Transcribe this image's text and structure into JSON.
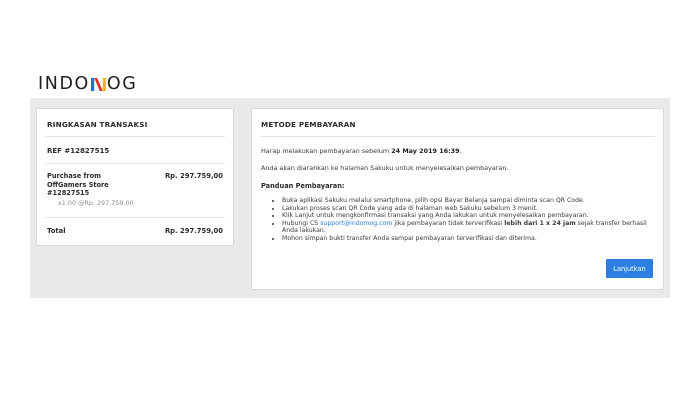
{
  "brand": {
    "logo_left": "INDO",
    "logo_right": "OG",
    "logo_mark": "m-icon"
  },
  "summary": {
    "title": "RINGKASAN TRANSAKSI",
    "ref": "REF #12827515",
    "item_name": "Purchase from OffGamers Store #12827515",
    "item_price": "Rp. 297.759,00",
    "item_qty": "x1.00 @Rp. 297.759,00",
    "total_label": "Total",
    "total_value": "Rp. 297.759,00"
  },
  "payment": {
    "title": "METODE PEMBAYARAN",
    "deadline_text": "Harap melakukan pembayaran sebelum",
    "deadline_value": "24 May 2019 16:39",
    "deadline_end": ".",
    "redirect_text": "Anda akan diarahkan ke halaman Sakuku untuk menyelesaikan pembayaran.",
    "guide_title": "Panduan Pembayaran:",
    "steps": [
      "Buka aplikasi Sakuku melalui smartphone, pilih opsi Bayar Belanja sampai diminta scan QR Code.",
      "Lakukan proses scan QR Code yang ada di halaman web Sakuku sebelum 3 menit.",
      "Klik Lanjut untuk mengkonfirmasi transaksi yang Anda lakukan untuk menyelesaikan pembayaran."
    ],
    "step4_a": "Hubungi CS",
    "step4_link": "support@indomog.com",
    "step4_b": "jika pembayaran tidak terverifikasi",
    "step4_bold": "lebih dari 1 x 24 jam",
    "step4_c": "sejak transfer berhasil Anda lakukan.",
    "step5": "Mohon simpan bukti transfer Anda sampai pembayaran terverifikasi dan diterima.",
    "button_label": "Lanjutkan"
  },
  "colors": {
    "accent": "#2c7fe0",
    "band": "#e9e9e9",
    "link": "#2b7fd3"
  }
}
